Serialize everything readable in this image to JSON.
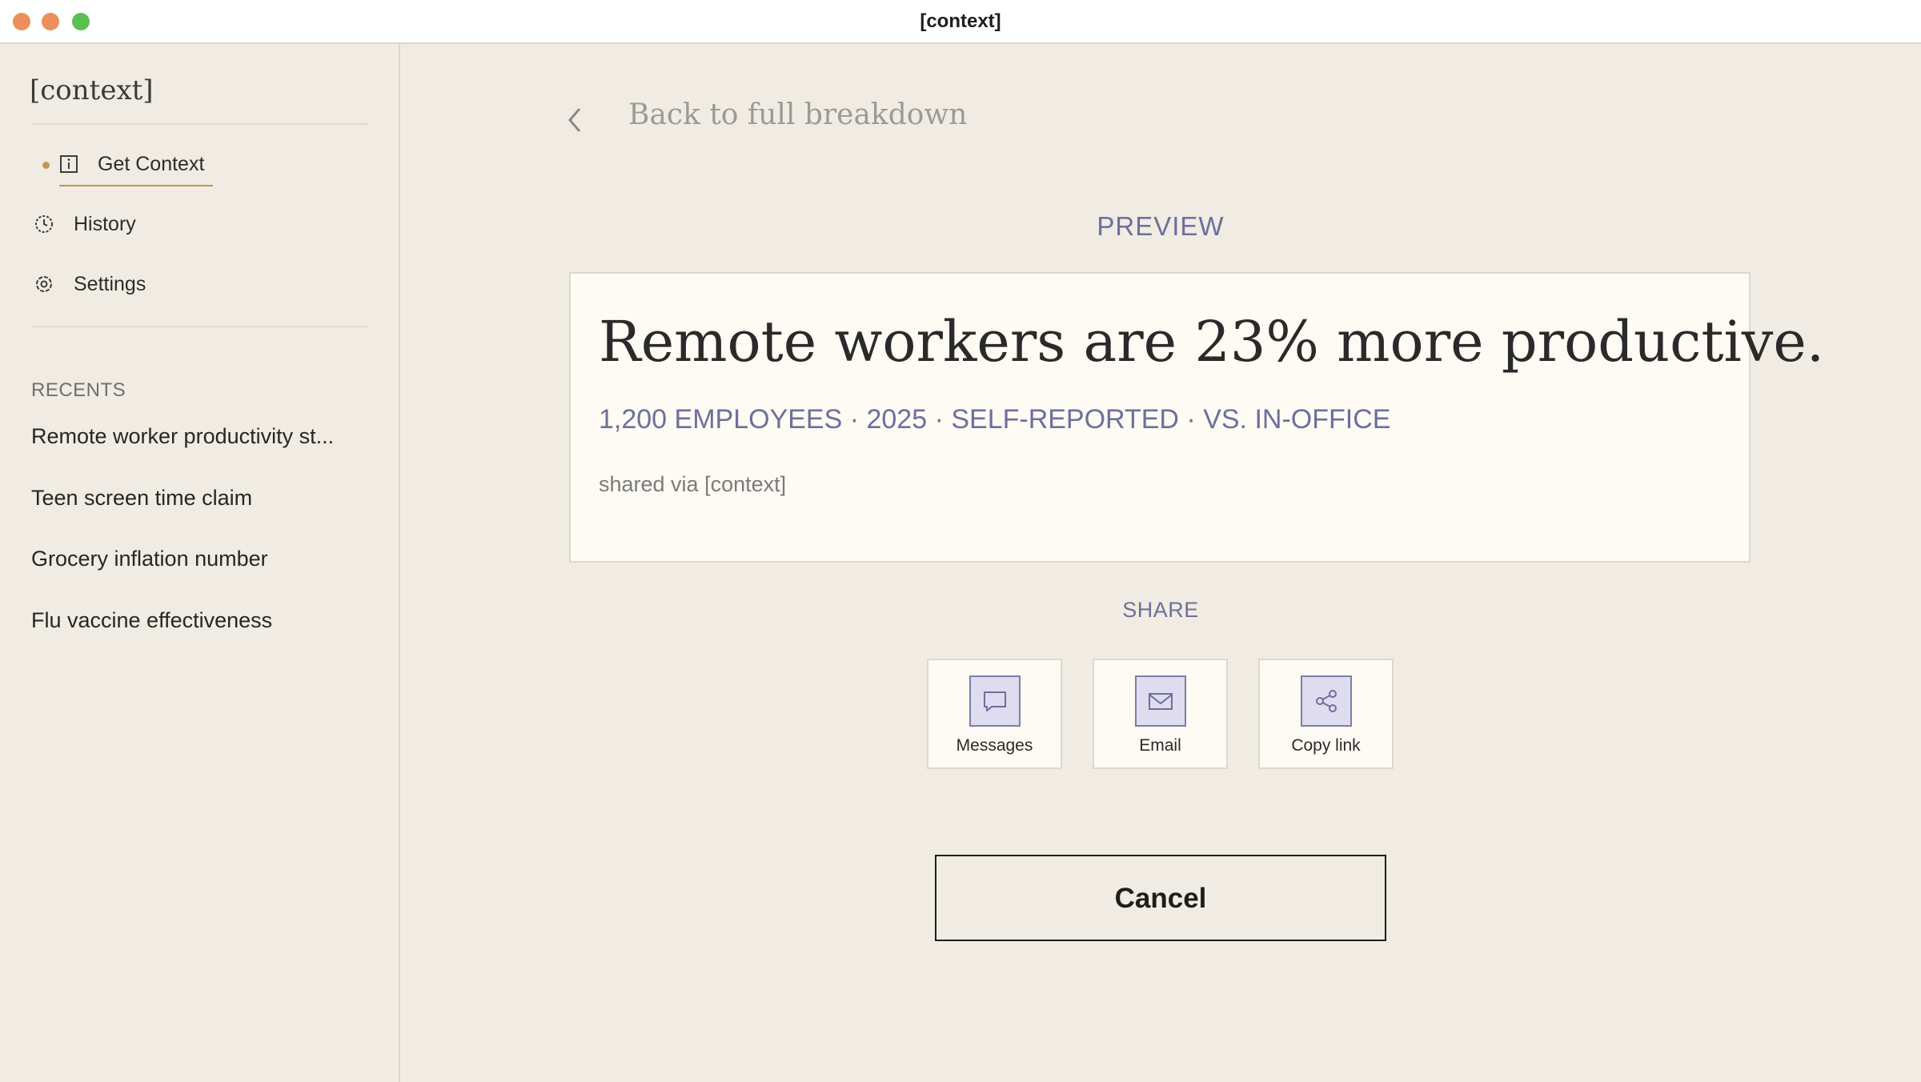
{
  "window": {
    "title": "[context]"
  },
  "sidebar": {
    "brand": "[context]",
    "nav": [
      {
        "label": "Get Context",
        "icon": "info-square-icon",
        "active": true
      },
      {
        "label": "History",
        "icon": "clock-icon",
        "active": false
      },
      {
        "label": "Settings",
        "icon": "gear-icon",
        "active": false
      }
    ],
    "recents_heading": "RECENTS",
    "recents": [
      "Remote worker productivity st...",
      "Teen screen time claim",
      "Grocery inflation number",
      "Flu vaccine effectiveness"
    ]
  },
  "main": {
    "back_label": "Back to full breakdown",
    "preview_label": "PREVIEW",
    "preview": {
      "headline": "Remote workers are 23% more productive.",
      "meta": "1,200 EMPLOYEES · 2025 · SELF-REPORTED · VS. IN-OFFICE",
      "shared_via": "shared via [context]"
    },
    "share_label": "SHARE",
    "share_options": [
      {
        "label": "Messages",
        "icon": "message-bubble-icon"
      },
      {
        "label": "Email",
        "icon": "envelope-icon"
      },
      {
        "label": "Copy link",
        "icon": "share-link-icon"
      }
    ],
    "cancel_label": "Cancel"
  },
  "colors": {
    "background": "#f0ece3",
    "card": "#fdfbf4",
    "accent_gold": "#c6954d",
    "accent_indigo": "#6d6f9c",
    "icon_fill": "#dedcee"
  }
}
